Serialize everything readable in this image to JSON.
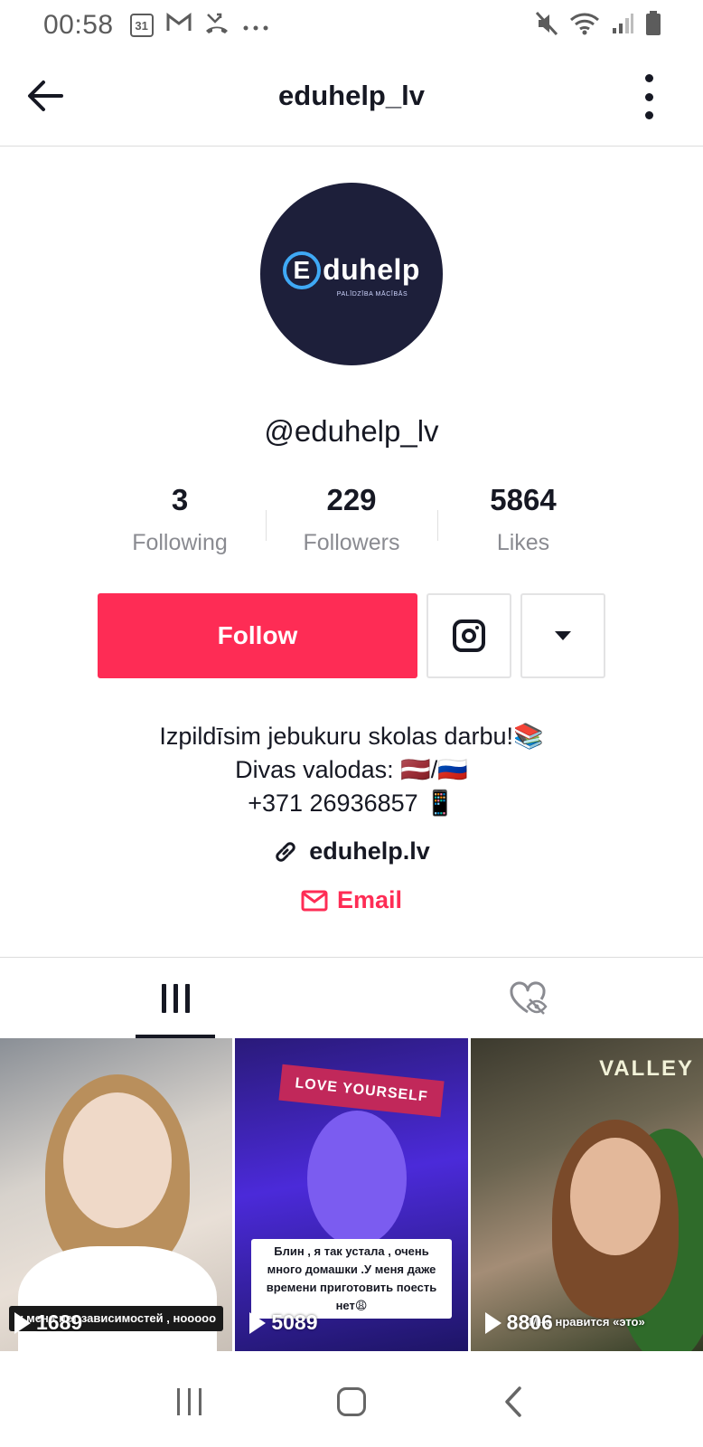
{
  "status_bar": {
    "time": "00:58",
    "calendar_day": "31",
    "icons_left": [
      "calendar-icon",
      "gmail-icon",
      "missed-call-icon",
      "more-notifications-icon"
    ],
    "icons_right": [
      "mute-icon",
      "wifi-icon",
      "signal-icon",
      "battery-icon"
    ]
  },
  "header": {
    "title": "eduhelp_lv"
  },
  "profile": {
    "avatar_logo_text": "Eduhelp",
    "avatar_logo_sub": "PALĪDZĪBA MĀCĪBĀS",
    "username": "@eduhelp_lv",
    "stats": [
      {
        "value": "3",
        "label": "Following"
      },
      {
        "value": "229",
        "label": "Followers"
      },
      {
        "value": "5864",
        "label": "Likes"
      }
    ],
    "follow_label": "Follow",
    "bio_lines": [
      "Izpildīsim jebukuru skolas darbu!📚",
      "Divas valodas: 🇱🇻/🇷🇺",
      "+371 26936857 📱"
    ],
    "link_text": "eduhelp.lv",
    "email_label": "Email"
  },
  "tabs": [
    {
      "name": "videos",
      "icon": "grid-icon",
      "active": true
    },
    {
      "name": "liked",
      "icon": "hidden-likes-icon",
      "active": false
    }
  ],
  "videos": [
    {
      "views": "1689",
      "caption": "у меня нет зависимостей , ноoooo"
    },
    {
      "views": "5089",
      "banner": "LOVE YOURSELF",
      "caption": "Блин , я так устала , очень много домашки .У меня даже времени приготовить поесть нет😩"
    },
    {
      "views": "8806",
      "sign": "VALLEY",
      "caption": "Мне нравится «это»"
    }
  ],
  "colors": {
    "accent": "#fe2c55",
    "text": "#161823",
    "muted": "#8a8b91"
  }
}
